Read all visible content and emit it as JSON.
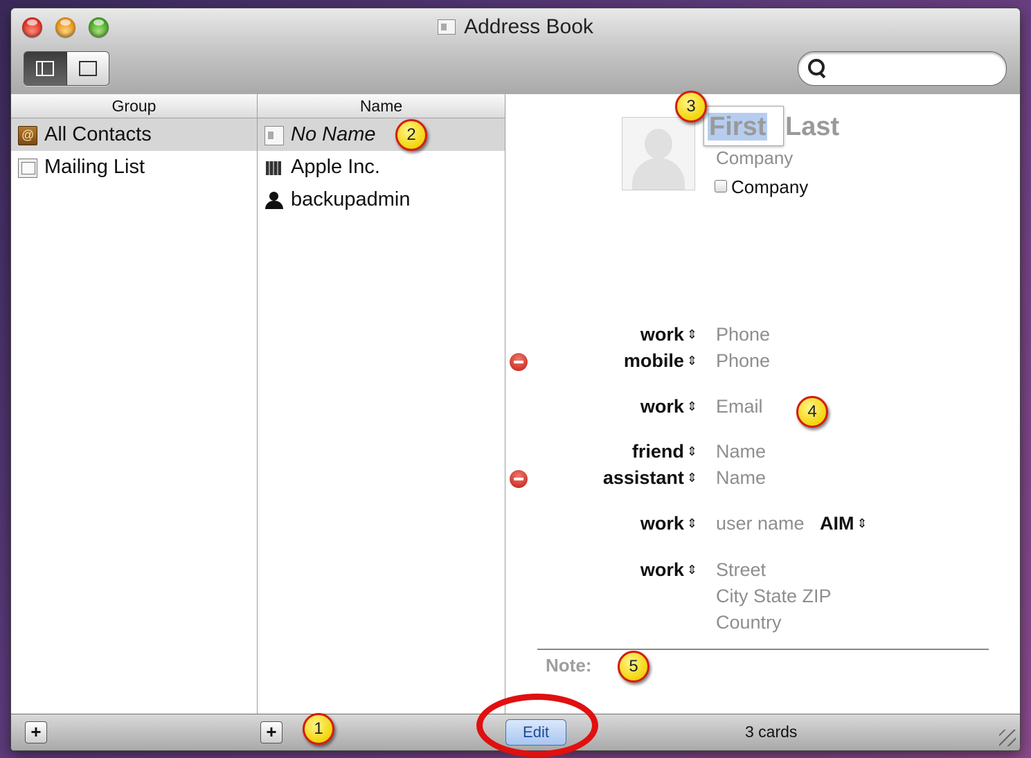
{
  "window": {
    "title": "Address Book"
  },
  "toolbar": {
    "search_placeholder": ""
  },
  "groups": {
    "header": "Group",
    "items": [
      {
        "label": "All Contacts",
        "icon": "address-book-icon",
        "selected": true
      },
      {
        "label": "Mailing List",
        "icon": "group-icon",
        "selected": false
      }
    ]
  },
  "names": {
    "header": "Name",
    "items": [
      {
        "label": "No Name",
        "icon": "card-icon",
        "selected": true
      },
      {
        "label": "Apple Inc.",
        "icon": "building-icon",
        "selected": false
      },
      {
        "label": "backupadmin",
        "icon": "person-icon",
        "selected": false
      }
    ]
  },
  "card": {
    "first": "First",
    "last": "Last",
    "company_placeholder": "Company",
    "company_checkbox_label": "Company",
    "fields": [
      {
        "label": "work",
        "value": "Phone"
      },
      {
        "label": "mobile",
        "value": "Phone"
      },
      {
        "label": "work",
        "value": "Email"
      },
      {
        "label": "friend",
        "value": "Name"
      },
      {
        "label": "assistant",
        "value": "Name"
      },
      {
        "label": "work",
        "value": "user name",
        "service": "AIM"
      },
      {
        "label": "work",
        "street": "Street",
        "city": "City State ZIP",
        "country": "Country"
      }
    ],
    "note_label": "Note:"
  },
  "footer": {
    "edit_label": "Edit",
    "count": "3 cards",
    "add_label": "+"
  },
  "annotations": [
    "1",
    "2",
    "3",
    "4",
    "5"
  ],
  "colors": {
    "selection": "#d6d6d6",
    "badge": "#f2d50a",
    "badge_border": "#d41c12",
    "ring": "#e01010"
  }
}
